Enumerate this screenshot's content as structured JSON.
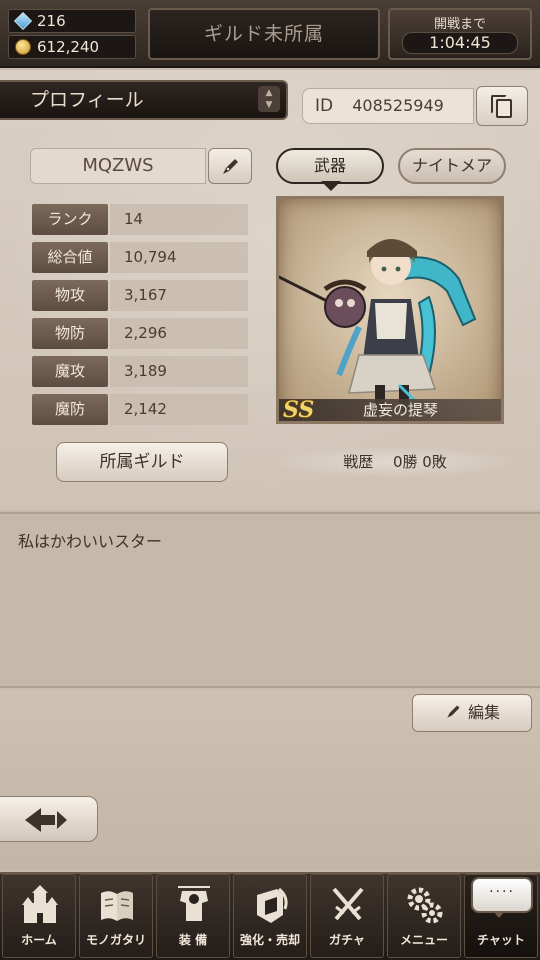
{
  "header": {
    "gems": "216",
    "coins": "612,240",
    "guild_status": "ギルド未所属",
    "battle_label": "開戦まで",
    "battle_timer": "1:04:45"
  },
  "profile": {
    "tab_title": "プロフィール",
    "id_label": "ID",
    "id_value": "408525949",
    "player_name": "MQZWS",
    "stats": [
      {
        "label": "ランク",
        "value": "14"
      },
      {
        "label": "総合値",
        "value": "10,794"
      },
      {
        "label": "物攻",
        "value": "3,167"
      },
      {
        "label": "物防",
        "value": "2,296"
      },
      {
        "label": "魔攻",
        "value": "3,189"
      },
      {
        "label": "魔防",
        "value": "2,142"
      }
    ],
    "guild_button": "所属ギルド"
  },
  "showcase": {
    "tabs": [
      {
        "label": "武器",
        "active": true
      },
      {
        "label": "ナイトメア",
        "active": false
      }
    ],
    "weapon": {
      "rarity": "SS",
      "name": "虚妄の提琴"
    },
    "record": "戦歴　 0勝 0敗"
  },
  "comment": {
    "text": "私はかわいいスター",
    "edit_label": "編集"
  },
  "nav": {
    "items": [
      {
        "label": "ホーム",
        "icon": "castle-icon"
      },
      {
        "label": "モノガタリ",
        "icon": "book-icon"
      },
      {
        "label": "装 備",
        "icon": "armor-icon"
      },
      {
        "label": "強化・売却",
        "icon": "enhance-icon"
      },
      {
        "label": "ガチャ",
        "icon": "crossed-swords-icon"
      },
      {
        "label": "メニュー",
        "icon": "gears-icon"
      },
      {
        "label": "チャット",
        "icon": "chat-icon"
      }
    ],
    "chat_bubble": "····"
  },
  "colors": {
    "panel": "#d9cfc3",
    "dark_bar": "#2e2621",
    "stat_label": "#6d5b4d",
    "gold": "#f0d36a"
  }
}
